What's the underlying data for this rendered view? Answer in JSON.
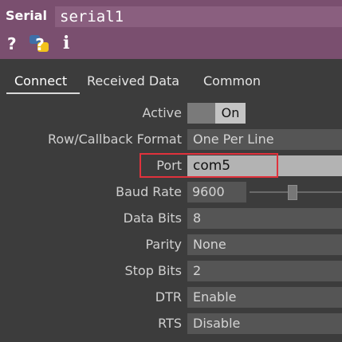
{
  "header": {
    "op_type": "Serial",
    "op_name": "serial1",
    "icons": [
      "help-icon",
      "python-help-icon",
      "info-icon"
    ],
    "help_glyph": "?",
    "info_glyph": "i",
    "accent_color": "#7a4f6f"
  },
  "tabs": [
    {
      "label": "Connect",
      "active": true
    },
    {
      "label": "Received Data",
      "active": false
    },
    {
      "label": "Common",
      "active": false
    }
  ],
  "params": {
    "active": {
      "label": "Active",
      "value": "On"
    },
    "row_callback_format": {
      "label": "Row/Callback Format",
      "value": "One Per Line"
    },
    "port": {
      "label": "Port",
      "value": "com5",
      "highlight_color": "#e0323c"
    },
    "baud_rate": {
      "label": "Baud Rate",
      "value": "9600"
    },
    "data_bits": {
      "label": "Data Bits",
      "value": "8"
    },
    "parity": {
      "label": "Parity",
      "value": "None"
    },
    "stop_bits": {
      "label": "Stop Bits",
      "value": "2"
    },
    "dtr": {
      "label": "DTR",
      "value": "Enable"
    },
    "rts": {
      "label": "RTS",
      "value": "Disable"
    }
  }
}
